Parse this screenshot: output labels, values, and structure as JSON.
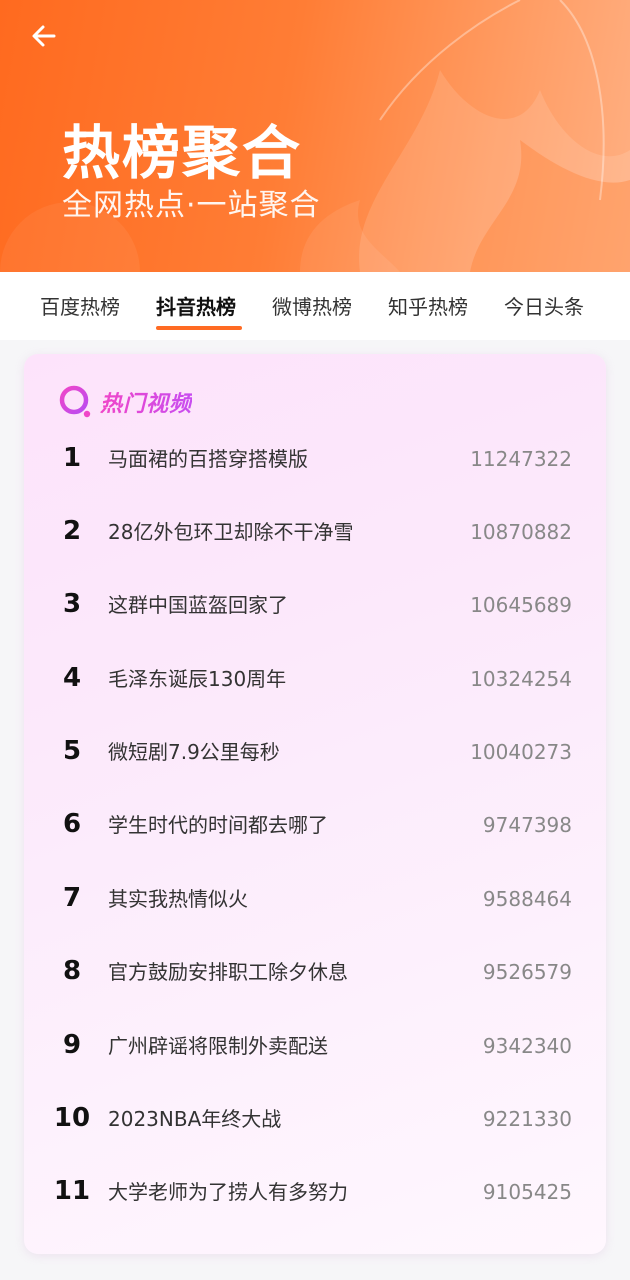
{
  "header": {
    "title": "热榜聚合",
    "subtitle": "全网热点·一站聚合",
    "back_icon": "arrow-left-icon",
    "gradient_colors": [
      "#ff6a1f",
      "#ffb083"
    ]
  },
  "tabs": [
    {
      "label": "百度热榜",
      "active": false
    },
    {
      "label": "抖音热榜",
      "active": true
    },
    {
      "label": "微博热榜",
      "active": false
    },
    {
      "label": "知乎热榜",
      "active": false
    },
    {
      "label": "今日头条",
      "active": false
    }
  ],
  "accent_color": "#ff6b23",
  "card": {
    "title": "热门视频",
    "icon": "search-icon",
    "title_color": "#e244d8",
    "items": [
      {
        "rank": "1",
        "title": "马面裙的百搭穿搭模版",
        "heat": "11247322"
      },
      {
        "rank": "2",
        "title": "28亿外包环卫却除不干净雪",
        "heat": "10870882"
      },
      {
        "rank": "3",
        "title": "这群中国蓝盔回家了",
        "heat": "10645689"
      },
      {
        "rank": "4",
        "title": "毛泽东诞辰130周年",
        "heat": "10324254"
      },
      {
        "rank": "5",
        "title": "微短剧7.9公里每秒",
        "heat": "10040273"
      },
      {
        "rank": "6",
        "title": "学生时代的时间都去哪了",
        "heat": "9747398"
      },
      {
        "rank": "7",
        "title": "其实我热情似火",
        "heat": "9588464"
      },
      {
        "rank": "8",
        "title": "官方鼓励安排职工除夕休息",
        "heat": "9526579"
      },
      {
        "rank": "9",
        "title": "广州辟谣将限制外卖配送",
        "heat": "9342340"
      },
      {
        "rank": "10",
        "title": "2023NBA年终大战",
        "heat": "9221330"
      },
      {
        "rank": "11",
        "title": "大学老师为了捞人有多努力",
        "heat": "9105425"
      }
    ]
  }
}
